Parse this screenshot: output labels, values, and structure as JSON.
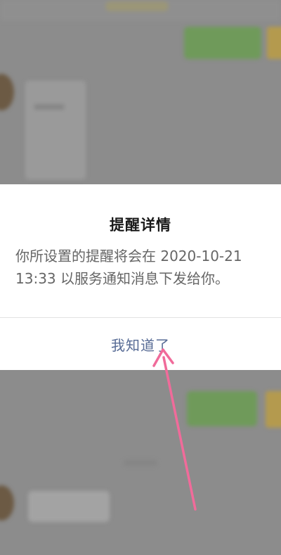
{
  "dialog": {
    "title": "提醒详情",
    "message": "你所设置的提醒将会在 2020-10-21 13:33 以服务通知消息下发给你。",
    "confirm_label": "我知道了"
  },
  "colors": {
    "dialog_background": "#ffffff",
    "title_text": "#1a1a1a",
    "message_text": "#666666",
    "button_text": "#576b95",
    "overlay": "#8c8c8c",
    "annotation_arrow": "#f06b9a"
  },
  "icons": {
    "annotation": "pink-arrow-icon"
  }
}
